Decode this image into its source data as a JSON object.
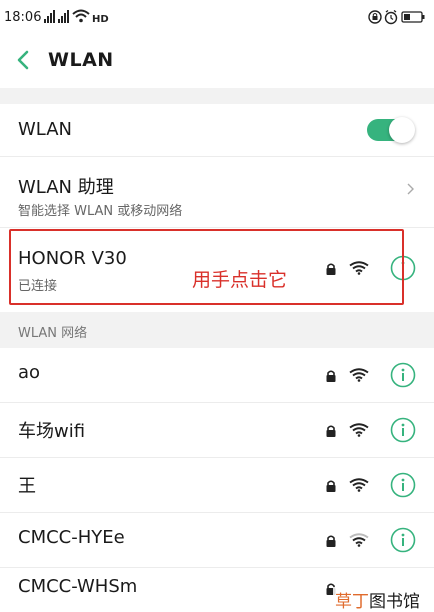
{
  "status_bar": {
    "time": "18:06",
    "left_icons": [
      "signal-icon",
      "signal-icon",
      "wifi-icon",
      "hd-icon"
    ],
    "right_icons": [
      "lock-icon",
      "alarm-icon",
      "battery-icon"
    ]
  },
  "header": {
    "back_icon": "chevron-left-icon",
    "title": "WLAN"
  },
  "wlan_toggle": {
    "label": "WLAN",
    "state": "on"
  },
  "wlan_assistant": {
    "title": "WLAN 助理",
    "subtitle": "智能选择 WLAN 或移动网络"
  },
  "connected_network": {
    "name": "HONOR V30",
    "status": "已连接"
  },
  "annotation": {
    "text": "用手点击它"
  },
  "section": {
    "label": "WLAN 网络"
  },
  "networks": [
    {
      "name": "ao"
    },
    {
      "name": "车场wifi"
    },
    {
      "name": "王"
    },
    {
      "name": "CMCC-HYEe"
    },
    {
      "name": "CMCC-WHSm"
    }
  ],
  "watermark": {
    "brand": "草丁",
    "rest": "图书馆"
  },
  "colors": {
    "accent": "#36b37e",
    "annotation_red": "#d9302a"
  }
}
